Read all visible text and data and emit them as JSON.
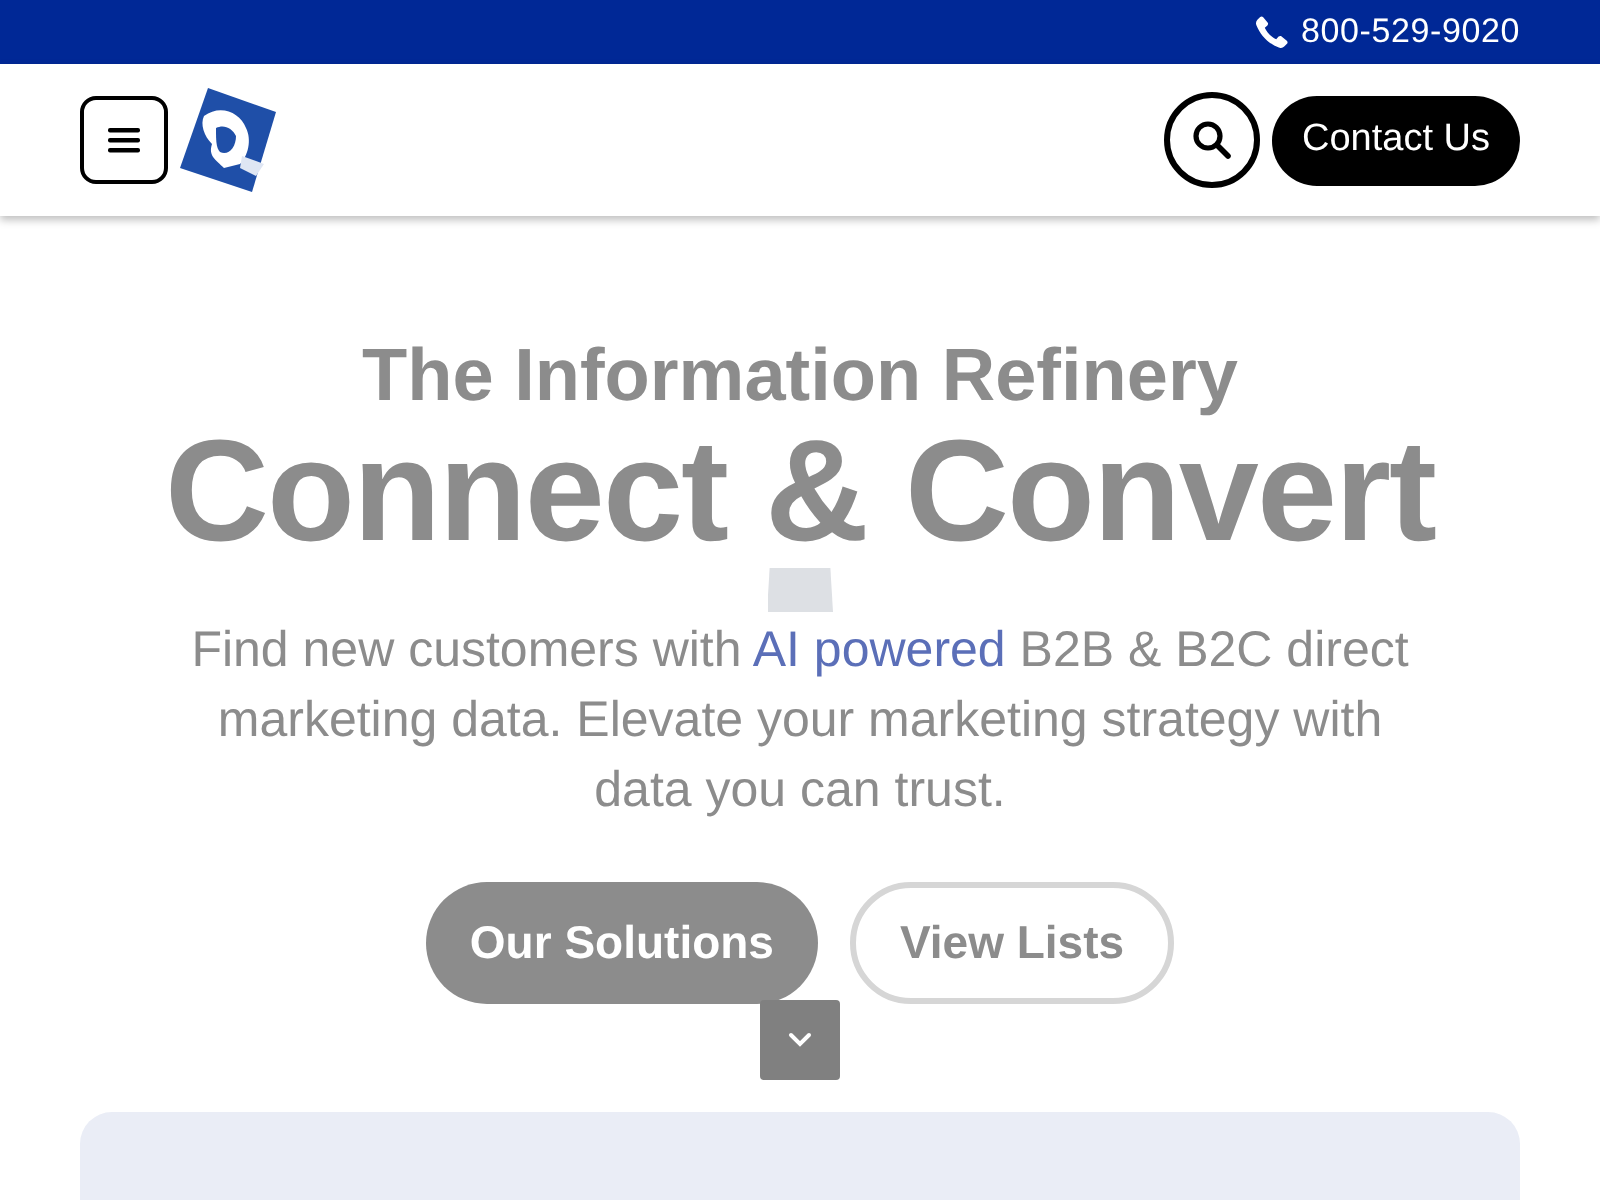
{
  "top_bar": {
    "phone": "800-529-9020"
  },
  "header": {
    "contact_button": "Contact Us"
  },
  "hero": {
    "eyebrow": "The Information Refinery",
    "headline": "Connect & Convert",
    "description": [
      {
        "text": "Find new customers with ",
        "highlight": false
      },
      {
        "text": "AI powered",
        "highlight": true
      },
      {
        "text": " B2B & B2C direct marketing data. Elevate your marketing strategy with data you can trust.",
        "highlight": false
      }
    ],
    "buttons": [
      {
        "label": "Our Solutions",
        "kind": "filled"
      },
      {
        "label": "View Lists",
        "kind": "outline"
      }
    ]
  }
}
